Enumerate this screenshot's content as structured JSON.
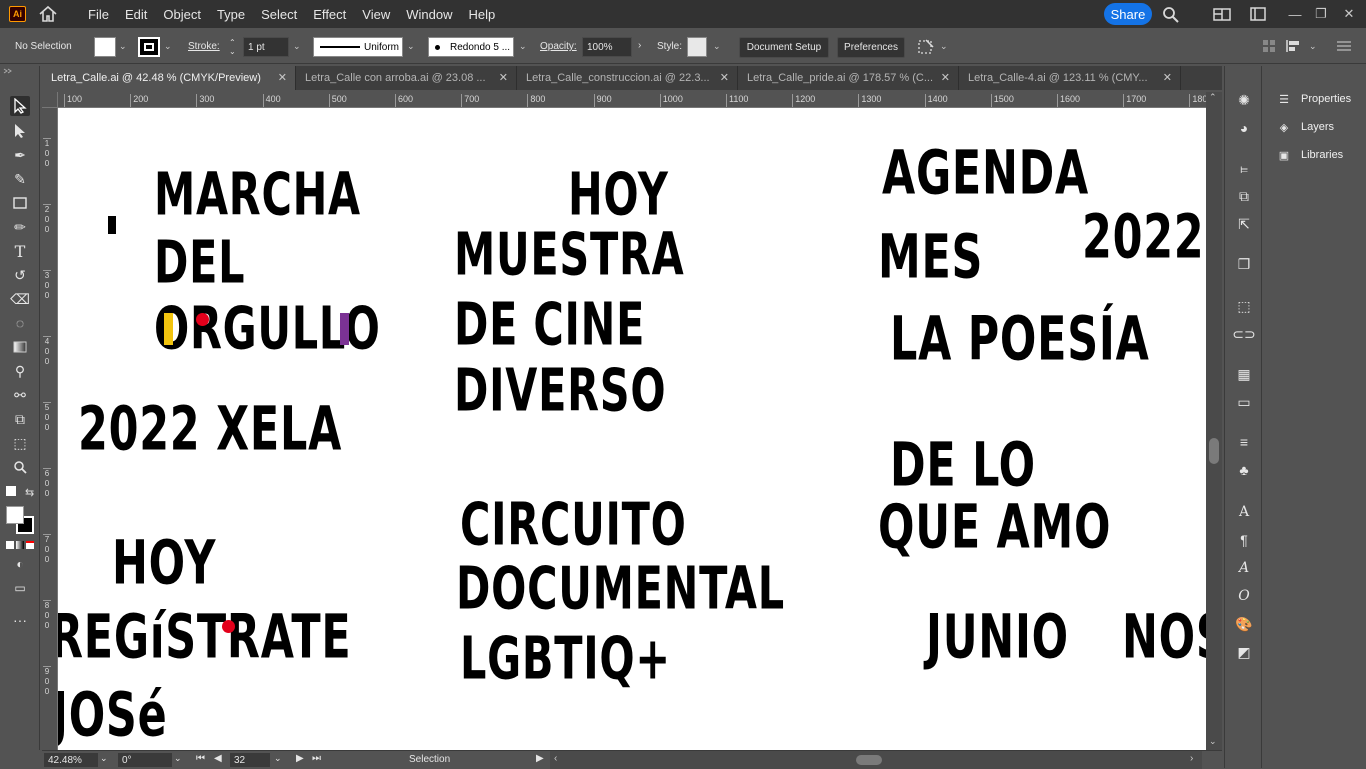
{
  "app": {
    "logo_text": "Ai"
  },
  "menu": [
    "File",
    "Edit",
    "Object",
    "Type",
    "Select",
    "Effect",
    "View",
    "Window",
    "Help"
  ],
  "share_label": "Share",
  "control_bar": {
    "selection_label": "No Selection",
    "stroke_label": "Stroke:",
    "stroke_weight": "1 pt",
    "stroke_profile": "Uniform",
    "brush": "Redondo 5 ...",
    "opacity_label": "Opacity:",
    "opacity_value": "100%",
    "style_label": "Style:",
    "document_setup": "Document Setup",
    "preferences": "Preferences"
  },
  "tabs": [
    {
      "label": "Letra_Calle.ai @ 42.48 % (CMYK/Preview)",
      "active": true
    },
    {
      "label": "Letra_Calle con arroba.ai @ 23.08 ...",
      "active": false
    },
    {
      "label": "Letra_Calle_construccion.ai @ 22.3...",
      "active": false
    },
    {
      "label": "Letra_Calle_pride.ai @ 178.57 % (C...",
      "active": false
    },
    {
      "label": "Letra_Calle-4.ai @ 123.11 % (CMY...",
      "active": false
    }
  ],
  "ruler_top": [
    "100",
    "200",
    "300",
    "400",
    "500",
    "600",
    "700",
    "800",
    "900",
    "1000",
    "1100",
    "1200",
    "1300",
    "1400",
    "1500",
    "1600",
    "1700",
    "180"
  ],
  "ruler_left": [
    "100",
    "200",
    "300",
    "400",
    "500",
    "600",
    "700",
    "800",
    "900"
  ],
  "artwork": {
    "marcha": "MARCHA",
    "del": "DEL",
    "orgullo": "ORGULLO",
    "xela": "2022 XELA",
    "hoy1": "HOY",
    "registrate": "REGíSTRATE",
    "jose": "JOSé",
    "hoy2": "HOY",
    "muestra": "MUESTRA",
    "decine": "DE CINE",
    "diverso": "DIVERSO",
    "circuito": "CIRCUITO",
    "documental": "DOCUMENTAL",
    "lgbtiq": "LGBTIQ+",
    "agenda": "AGENDA",
    "y2022": "2022",
    "mes": "MES",
    "poesia": "LA POESÍA",
    "delo": "DE LO",
    "queamo": "QUE AMO",
    "junio": "JUNIO",
    "nos": "NOS"
  },
  "colors": {
    "yellow_bar": "#f2c40f",
    "red_dot": "#e3001b",
    "purple_bar": "#7b3294",
    "share_blue": "#1473e6"
  },
  "status": {
    "zoom": "42.48%",
    "rotation": "0°",
    "artboard": "32",
    "tool": "Selection"
  },
  "right_panel": {
    "properties": "Properties",
    "layers": "Layers",
    "libraries": "Libraries"
  }
}
